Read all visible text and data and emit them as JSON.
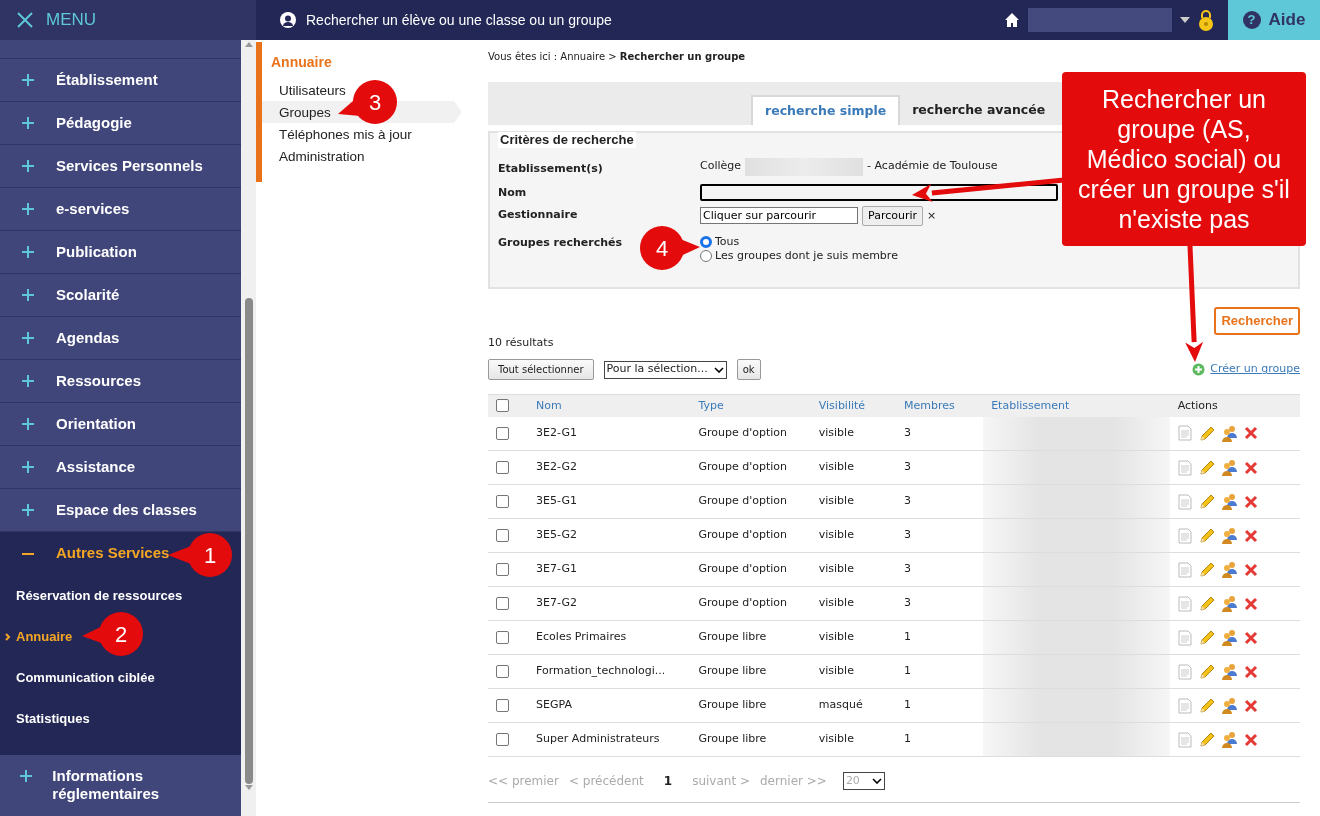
{
  "topbar": {
    "menu_label": "MENU",
    "search_placeholder": "Rechercher un élève ou une classe ou un groupe",
    "help_icon": "?",
    "help_label": "Aide"
  },
  "sidebar": {
    "items": [
      {
        "label": "Établissement",
        "expanded": false
      },
      {
        "label": "Pédagogie",
        "expanded": false
      },
      {
        "label": "Services Personnels",
        "expanded": false
      },
      {
        "label": "e-services",
        "expanded": false
      },
      {
        "label": "Publication",
        "expanded": false
      },
      {
        "label": "Scolarité",
        "expanded": false
      },
      {
        "label": "Agendas",
        "expanded": false
      },
      {
        "label": "Ressources",
        "expanded": false
      },
      {
        "label": "Orientation",
        "expanded": false
      },
      {
        "label": "Assistance",
        "expanded": false
      },
      {
        "label": "Espace des classes",
        "expanded": false
      },
      {
        "label": "Autres Services",
        "expanded": true,
        "children": [
          {
            "label": "Réservation de ressources",
            "selected": false
          },
          {
            "label": "Annuaire",
            "selected": true
          },
          {
            "label": "Communication ciblée",
            "selected": false
          },
          {
            "label": "Statistiques",
            "selected": false
          }
        ]
      },
      {
        "label": "Informations réglementaires",
        "expanded": false
      }
    ]
  },
  "submenu": {
    "title": "Annuaire",
    "items": [
      {
        "label": "Utilisateurs",
        "selected": false
      },
      {
        "label": "Groupes",
        "selected": true
      },
      {
        "label": "Téléphones mis à jour",
        "selected": false
      },
      {
        "label": "Administration",
        "selected": false
      }
    ]
  },
  "breadcrumb": "Vous êtes ici : Annuaire > **Rechercher un groupe**",
  "tabs": [
    {
      "label": "recherche simple",
      "selected": true
    },
    {
      "label": "recherche avancée",
      "selected": false
    }
  ],
  "criteria": {
    "legend": "Critères de recherche",
    "etablissement": {
      "label": "Etablissement(s)",
      "prefix": "Collège",
      "suffix": "- Académie de Toulouse"
    },
    "nom": {
      "label": "Nom"
    },
    "gestionnaire": {
      "label": "Gestionnaire",
      "value": "Cliquer sur parcourir",
      "button": "Parcourir",
      "clear": "×"
    },
    "groupes": {
      "label": "Groupes recherchés",
      "options": [
        {
          "label": "Tous",
          "selected": true
        },
        {
          "label": "Les groupes dont je suis membre",
          "selected": false
        }
      ]
    }
  },
  "search_button": "Rechercher",
  "result_count": "10 résultats",
  "toolbar": {
    "select_all": "Tout sélectionner",
    "action_select": "Pour la sélection...",
    "ok": "ok",
    "create": "Créer un groupe"
  },
  "table": {
    "select_all_checked": false,
    "columns": [
      "Nom",
      "Type",
      "Visibilité",
      "Membres",
      "Etablissement",
      "Actions"
    ],
    "rows": [
      {
        "nom": "3E2-G1",
        "type": "Groupe d'option",
        "visibilite": "visible",
        "membres": "3",
        "checked": false
      },
      {
        "nom": "3E2-G2",
        "type": "Groupe d'option",
        "visibilite": "visible",
        "membres": "3",
        "checked": false
      },
      {
        "nom": "3E5-G1",
        "type": "Groupe d'option",
        "visibilite": "visible",
        "membres": "3",
        "checked": false
      },
      {
        "nom": "3E5-G2",
        "type": "Groupe d'option",
        "visibilite": "visible",
        "membres": "3",
        "checked": false
      },
      {
        "nom": "3E7-G1",
        "type": "Groupe d'option",
        "visibilite": "visible",
        "membres": "3",
        "checked": false
      },
      {
        "nom": "3E7-G2",
        "type": "Groupe d'option",
        "visibilite": "visible",
        "membres": "3",
        "checked": false
      },
      {
        "nom": "Ecoles Primaires",
        "type": "Groupe libre",
        "visibilite": "visible",
        "membres": "1",
        "checked": false
      },
      {
        "nom": "Formation_technologi...",
        "type": "Groupe libre",
        "visibilite": "visible",
        "membres": "1",
        "checked": false
      },
      {
        "nom": "SEGPA",
        "type": "Groupe libre",
        "visibilite": "masqué",
        "membres": "1",
        "checked": false
      },
      {
        "nom": "Super Administrateurs",
        "type": "Groupe libre",
        "visibilite": "visible",
        "membres": "1",
        "checked": false
      }
    ]
  },
  "pagination": {
    "first": "<< premier",
    "prev": "< précédent",
    "current": "1",
    "next": "suivant >",
    "last": "dernier >>",
    "page_size": "20"
  },
  "annotations": {
    "callouts": [
      "1",
      "2",
      "3",
      "4"
    ],
    "note": "Rechercher un groupe (AS, Médico social) ou créer un groupe s'il n'existe pas"
  }
}
